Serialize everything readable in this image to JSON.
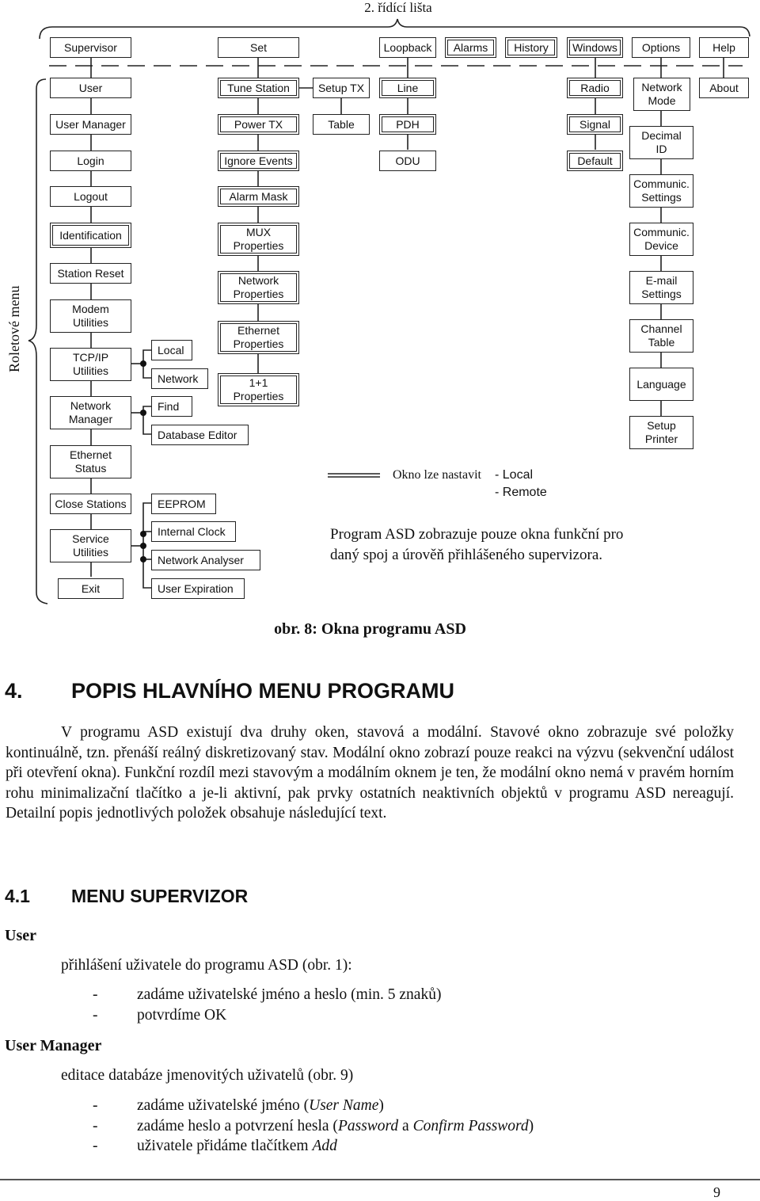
{
  "diagram": {
    "top_label": "2. řídící lišta",
    "side_label": "Roletové menu",
    "toolbar": [
      {
        "id": "supervisor",
        "label": "Supervisor",
        "dbl": false
      },
      {
        "id": "set",
        "label": "Set",
        "dbl": false
      },
      {
        "id": "loopback",
        "label": "Loopback",
        "dbl": false
      },
      {
        "id": "alarms",
        "label": "Alarms",
        "dbl": true
      },
      {
        "id": "history",
        "label": "History",
        "dbl": true
      },
      {
        "id": "windows",
        "label": "Windows",
        "dbl": true
      },
      {
        "id": "options",
        "label": "Options",
        "dbl": false
      },
      {
        "id": "help",
        "label": "Help",
        "dbl": false
      }
    ],
    "supervisor_menu": [
      {
        "label": "User",
        "dbl": false
      },
      {
        "label": "User Manager",
        "dbl": false
      },
      {
        "label": "Login",
        "dbl": false
      },
      {
        "label": "Logout",
        "dbl": false
      },
      {
        "label": "Identification",
        "dbl": true
      },
      {
        "label": "Station Reset",
        "dbl": false
      },
      {
        "label": "Modem\nUtilities",
        "dbl": false
      },
      {
        "label": "TCP/IP\nUtilities",
        "dbl": false
      },
      {
        "label": "Network\nManager",
        "dbl": false
      },
      {
        "label": "Ethernet\nStatus",
        "dbl": false
      },
      {
        "label": "Close Stations",
        "dbl": false
      },
      {
        "label": "Service\nUtilities",
        "dbl": false
      },
      {
        "label": "Exit",
        "dbl": false
      }
    ],
    "tcpip_submenu": [
      "Local",
      "Network"
    ],
    "network_manager_submenu": [
      "Find",
      "Database Editor"
    ],
    "service_submenu": [
      "EEPROM",
      "Internal Clock",
      "Network  Analyser",
      "User Expiration"
    ],
    "set_menu": [
      {
        "label": "Tune Station",
        "dbl": true
      },
      {
        "label": "Power TX",
        "dbl": true
      },
      {
        "label": "Ignore Events",
        "dbl": true
      },
      {
        "label": "Alarm Mask",
        "dbl": true
      },
      {
        "label": "MUX\nProperties",
        "dbl": true
      },
      {
        "label": "Network\nProperties",
        "dbl": true
      },
      {
        "label": "Ethernet\nProperties",
        "dbl": true
      },
      {
        "label": "1+1\nProperties",
        "dbl": true
      }
    ],
    "setup_tx_menu": [
      {
        "label": "Setup TX",
        "dbl": false
      },
      {
        "label": "Table",
        "dbl": false
      }
    ],
    "loopback_menu": [
      {
        "label": "Line",
        "dbl": true
      },
      {
        "label": "PDH",
        "dbl": true
      },
      {
        "label": "ODU",
        "dbl": false
      }
    ],
    "windows_menu": [
      {
        "label": "Radio",
        "dbl": true
      },
      {
        "label": "Signal",
        "dbl": true
      },
      {
        "label": "Default",
        "dbl": true
      }
    ],
    "options_menu": [
      {
        "label": "Network\nMode",
        "dbl": false
      },
      {
        "label": "Decimal\nID",
        "dbl": false
      },
      {
        "label": "Communic.\nSettings",
        "dbl": false
      },
      {
        "label": "Communic.\nDevice",
        "dbl": false
      },
      {
        "label": "E-mail\nSettings",
        "dbl": false
      },
      {
        "label": "Channel\nTable",
        "dbl": false
      },
      {
        "label": "Language",
        "dbl": false
      },
      {
        "label": "Setup\nPrinter",
        "dbl": false
      }
    ],
    "help_menu": [
      {
        "label": "About",
        "dbl": false
      }
    ],
    "legend": {
      "text": "Okno lze nastavit",
      "opt1": "- Local",
      "opt2": "- Remote"
    },
    "note_line1": "Program ASD zobrazuje pouze okna funkční pro",
    "note_line2": "daný spoj a úrověň přihlášeného supervizora."
  },
  "caption": "obr. 8: Okna programu ASD",
  "section4": {
    "number": "4.",
    "title": "POPIS HLAVNÍHO MENU PROGRAMU",
    "paragraph": "V programu ASD existují dva druhy oken, stavová a modální. Stavové okno zobrazuje své položky kontinuálně, tzn. přenáší reálný diskretizovaný stav. Modální okno zobrazí pouze reakci na výzvu (sekvenční událost při otevření okna). Funkční rozdíl mezi stavovým a modálním oknem je ten, že modální okno nemá v pravém horním rohu minimalizační tlačítko a je-li aktivní, pak prvky ostatních neaktivních objektů v programu ASD nereagují. Detailní popis jednotlivých položek obsahuje následující text."
  },
  "section41": {
    "number": "4.1",
    "title": "MENU SUPERVIZOR",
    "user": {
      "heading": "User",
      "intro": "přihlášení uživatele do programu ASD (obr. 1):",
      "bullets": [
        "zadáme uživatelské jméno a heslo (min. 5 znaků)",
        "potvrdíme OK"
      ]
    },
    "user_manager": {
      "heading": "User Manager",
      "intro": "editace databáze jmenovitých uživatelů (obr. 9)",
      "b1_pre": "zadáme uživatelské jméno (",
      "b1_it": "User Name",
      "b1_post": ")",
      "b2_pre": "zadáme heslo a potvrzení hesla (",
      "b2_it1": "Password",
      "b2_mid": " a ",
      "b2_it2": "Confirm Password",
      "b2_post": ")",
      "b3_pre": "uživatele přidáme tlačítkem ",
      "b3_it": "Add"
    },
    "dash": "-"
  },
  "page_number": "9"
}
